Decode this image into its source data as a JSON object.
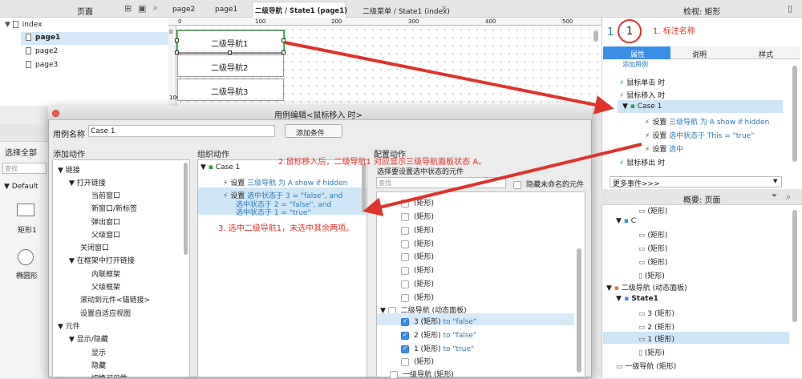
{
  "pages_panel": {
    "title": "页面",
    "items": [
      "index",
      "page1",
      "page2",
      "page3"
    ]
  },
  "tabs": [
    "page2",
    "page1",
    "二级导航 / State1 (page1)",
    "二级菜单 / State1 (index)"
  ],
  "ruler_marks": [
    "0",
    "100",
    "200",
    "300",
    "400",
    "500",
    "600"
  ],
  "ruler_v_marks": [
    "0",
    "100"
  ],
  "canvas_items": [
    "二级导航1",
    "二级导航2",
    "二级导航3"
  ],
  "library": {
    "select_all": "选择全部",
    "search": "查找",
    "default_label": "Default",
    "shapes": [
      "矩形1",
      "椭圆形"
    ]
  },
  "inspector": {
    "title": "检视: 矩形",
    "name_value": "1",
    "name_prefix": "1",
    "tabs": [
      "属性",
      "说明",
      "样式"
    ],
    "add_case": "添加用例",
    "ev_click": "鼠标单击 时",
    "ev_enter": "鼠标移入 时",
    "case1": "Case 1",
    "act1_prefix": "设置 ",
    "act1_colored": "三级导航 为 A show if hidden",
    "act2_prefix": "设置 ",
    "act2_colored": "选中状态于 This = \"true\"",
    "act3_prefix": "设置 ",
    "act3_colored": "选中",
    "ev_leave": "鼠标移出 时",
    "more_events": "更多事件>>>"
  },
  "outline": {
    "title": "概要: 页面",
    "items": [
      "(矩形)",
      "C",
      "(矩形)",
      "(矩形)",
      "(矩形)",
      "(矩形)",
      "二级导航 (动态面板)",
      "State1",
      "3 (矩形)",
      "2 (矩形)",
      "1 (矩形)",
      "(矩形)",
      "一级导航 (矩形)"
    ]
  },
  "dialog": {
    "title": "用例编辑<鼠标移入 时>",
    "case_name_label": "用例名称",
    "case_name_value": "Case 1",
    "add_condition": "添加条件",
    "col1_title": "添加动作",
    "col2_title": "组织动作",
    "col3_title": "配置动作",
    "actions": [
      "链接",
      "打开链接",
      "当前窗口",
      "新窗口/新标签",
      "弹出窗口",
      "父级窗口",
      "关闭窗口",
      "在框架中打开链接",
      "内联框架",
      "父级框架",
      "滚动到元件<锚链接>",
      "设置自适应视图",
      "元件",
      "显示/隐藏",
      "显示",
      "隐藏",
      "切换可见性"
    ],
    "org_case": "Case 1",
    "org_a1_prefix": "设置 ",
    "org_a1_colored": "三级导航 为 A show if hidden",
    "org_a2_line1_prefix": "设置 ",
    "org_a2_line1": "选中状态于 3 = \"false\", and",
    "org_a2_line2": "选中状态于 2 = \"false\", and",
    "org_a2_line3": "选中状态于 1 = \"true\"",
    "config_subtitle": "选择要设置选中状态的元件",
    "config_search": "查找",
    "hide_unnamed": "隐藏未命名的元件",
    "config_items": [
      "(矩形)",
      "(矩形)",
      "(矩形)",
      "(矩形)",
      "(矩形)",
      "(矩形)",
      "(矩形)",
      "(矩形)"
    ],
    "panel_item": "二级导航 (动态面板)",
    "checked_items": [
      {
        "label": "3 (矩形)",
        "value": "to \"false\""
      },
      {
        "label": "2 (矩形)",
        "value": "to \"false\""
      },
      {
        "label": "1 (矩形)",
        "value": "to \"true\""
      }
    ],
    "last_rect": "(矩形)",
    "nav1": "一级导航 (矩形)"
  },
  "annotations": {
    "a1": "1. 标注名称",
    "a2": "2.鼠标移入后，二级导航1 对应显示三级导航面板状态 A。",
    "a3": "3. 选中二级导航1，未选中其余两项。"
  },
  "colors": {
    "accent": "#3a8ee6",
    "annotation": "#e0332b",
    "highlight": "#cfe6f7"
  }
}
